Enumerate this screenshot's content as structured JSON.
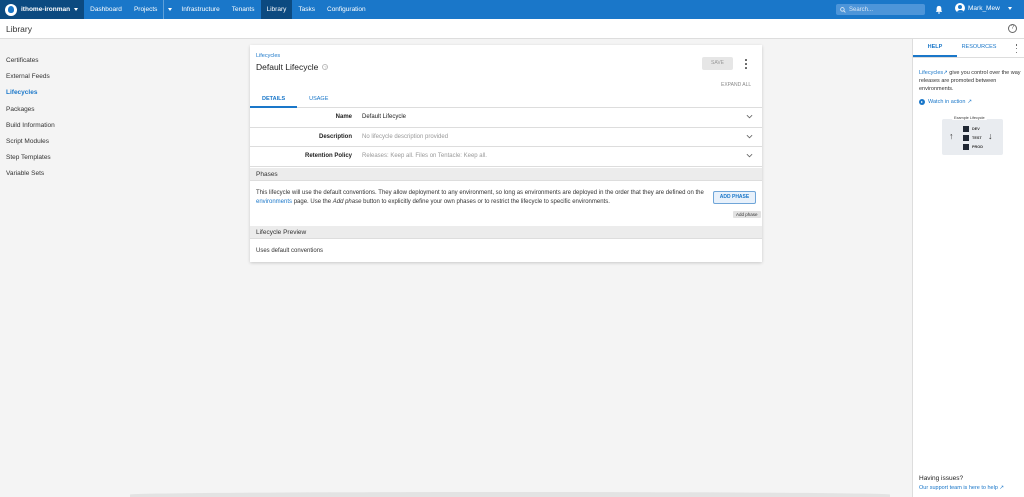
{
  "topnav": {
    "space": "ithome-ironman",
    "items": [
      "Dashboard",
      "Projects",
      "Infrastructure",
      "Tenants",
      "Library",
      "Tasks",
      "Configuration"
    ],
    "search_placeholder": "Search...",
    "user": "Mark_Mew",
    "accent": "#1a77c9"
  },
  "page": {
    "title": "Library"
  },
  "sidebar": {
    "items": [
      "Certificates",
      "External Feeds",
      "Lifecycles",
      "Packages",
      "Build Information",
      "Script Modules",
      "Step Templates",
      "Variable Sets"
    ],
    "active": "Lifecycles"
  },
  "card": {
    "breadcrumb": "Lifecycles",
    "title": "Default Lifecycle",
    "save_label": "SAVE",
    "expand_all": "EXPAND ALL",
    "tabs": [
      "DETAILS",
      "USAGE"
    ],
    "fields": [
      {
        "label": "Name",
        "value": "Default Lifecycle"
      },
      {
        "label": "Description",
        "value": "No lifecycle description provided"
      },
      {
        "label": "Retention Policy",
        "value": "Releases: Keep all. Files on Tentacle: Keep all."
      }
    ],
    "phases": {
      "heading": "Phases",
      "text_1": "This lifecycle will use the default conventions. They allow deployment to any environment, so long as environments are deployed in the order that they are defined on the ",
      "link": "environments",
      "text_2": " page. Use the ",
      "emphasis": "Add phase",
      "text_3": " button to explicitly define your own phases or to restrict the lifecycle to specific environments.",
      "button": "ADD PHASE",
      "tooltip": "Add phase"
    },
    "preview": {
      "heading": "Lifecycle Preview",
      "text": "Uses default conventions"
    }
  },
  "help": {
    "tabs": [
      "HELP",
      "RESOURCES"
    ],
    "link": "Lifecycles",
    "desc": " give you control over the way releases are promoted between environments.",
    "watch": "Watch in action",
    "diagram_title": "Example Lifecycle",
    "envs": [
      "DEV",
      "TEST",
      "PROD"
    ],
    "issues": "Having issues?",
    "support": "Our support team is here to help"
  }
}
